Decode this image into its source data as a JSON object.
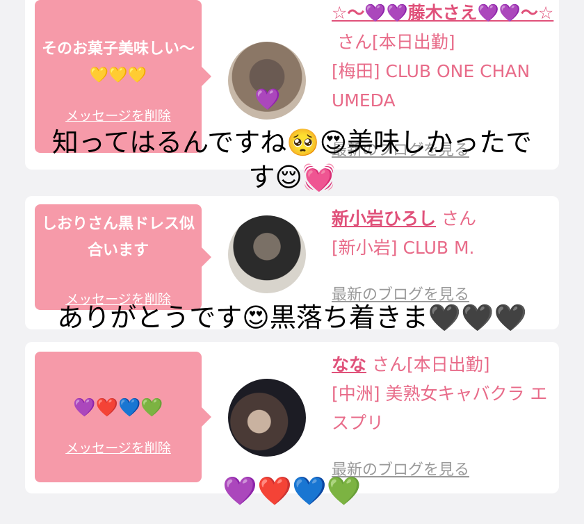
{
  "cards": [
    {
      "message": "そのお菓子美味しい〜💛💛💛",
      "delete_label": "メッセージを削除",
      "name": "☆〜💜💜藤木さえ💜💜〜☆",
      "honorific": "さん[本日出勤]",
      "shop": "[梅田] CLUB ONE CHAN UMEDA",
      "blog": "最新のブログを見る"
    },
    {
      "message": "しおりさん黒ドレス似合います",
      "delete_label": "メッセージを削除",
      "name": "新小岩ひろし",
      "honorific": "さん",
      "shop": "[新小岩] CLUB M.",
      "blog": "最新のブログを見る"
    },
    {
      "message": "💜❤️💙💚",
      "delete_label": "メッセージを削除",
      "name": "なな",
      "honorific": "さん[本日出勤]",
      "shop": "[中洲] 美熟女キャバクラ エスプリ",
      "blog": "最新のブログを見る"
    }
  ],
  "overlays": {
    "caption1_line1": "知ってはるんですね🥺😍美味しかったで",
    "caption1_line2": "す😌💓",
    "caption2": "ありがとうです😍黒落ち着きま🖤🖤🖤",
    "caption3": "💜❤️💙💚"
  },
  "colors": {
    "bubble": "#f69aa9",
    "name": "#e0517a",
    "text_pink": "#e86b89",
    "background": "#f2f2f4"
  }
}
